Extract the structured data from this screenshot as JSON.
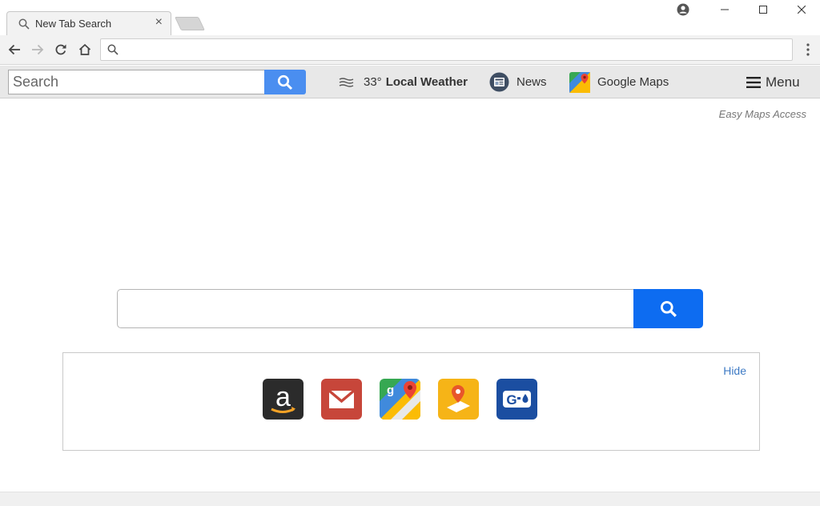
{
  "tab": {
    "title": "New Tab Search",
    "close": "×"
  },
  "window": {
    "minimize": "–",
    "maximize": "☐",
    "close": "✕"
  },
  "extension_bar": {
    "search_placeholder": "Search",
    "weather_temp": "33°",
    "weather_label": "Local Weather",
    "news_label": "News",
    "maps_label": "Google Maps",
    "menu_label": "Menu"
  },
  "page": {
    "tagline": "Easy Maps Access",
    "hide_label": "Hide",
    "shortcuts": [
      {
        "name": "Amazon",
        "icon": "amazon-icon",
        "color": "#2b2b2b"
      },
      {
        "name": "Gmail",
        "icon": "gmail-icon",
        "color": "#c7463a"
      },
      {
        "name": "Google Maps",
        "icon": "google-maps-icon",
        "color": "#ffffff"
      },
      {
        "name": "Bing Maps",
        "icon": "bing-maps-icon",
        "color": "#f6b417"
      },
      {
        "name": "Gas Prices",
        "icon": "gas-prices-icon",
        "color": "#1b4ea1"
      }
    ]
  },
  "colors": {
    "accent_blue": "#4a8ef0",
    "main_search_blue": "#0d6cf1",
    "link_blue": "#3d7ac4"
  }
}
